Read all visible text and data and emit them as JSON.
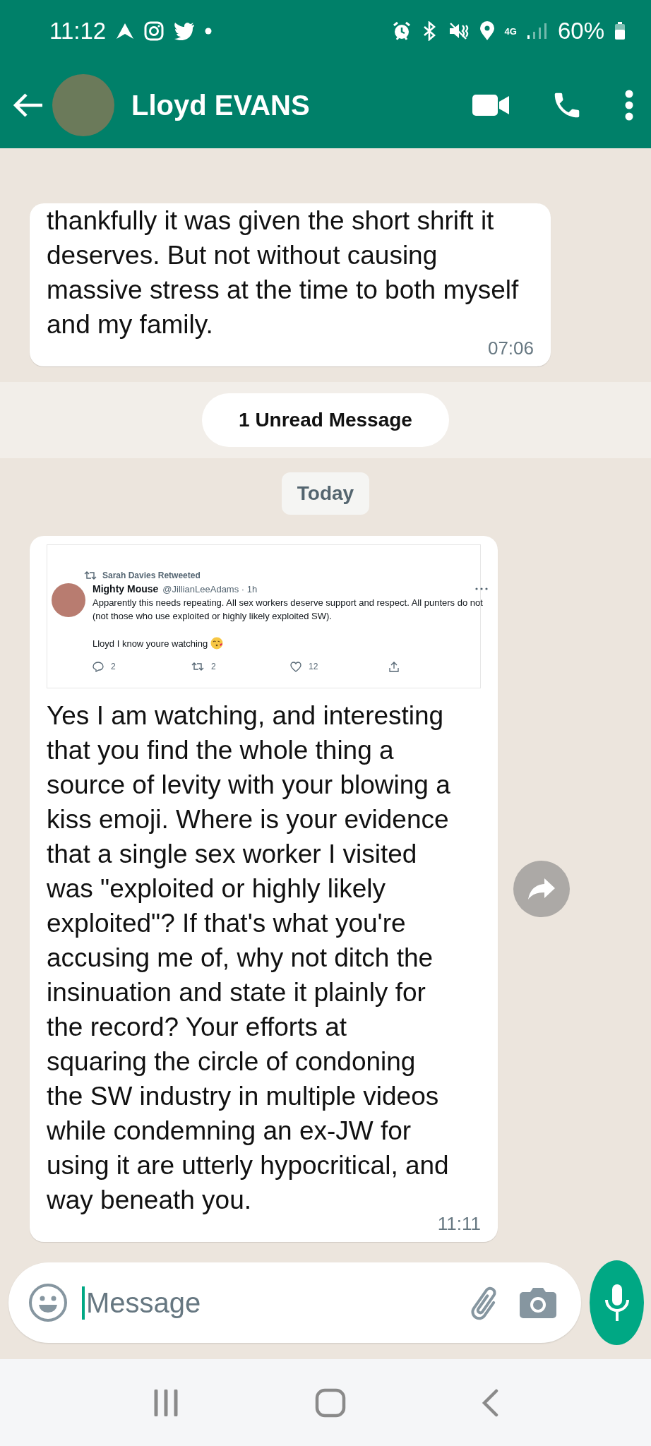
{
  "status_bar": {
    "time": "11:12",
    "network": "4G",
    "battery": "60%"
  },
  "header": {
    "contact_name": "Lloyd EVANS"
  },
  "chat": [
    {
      "kind": "message",
      "text": "thankfully it was given the short shrift it deserves. But not without causing massive stress at the time to both myself and my family.",
      "time": "07:06"
    },
    {
      "kind": "unread",
      "text": "1 Unread Message"
    },
    {
      "kind": "date",
      "text": "Today"
    },
    {
      "kind": "message",
      "forward_button": true,
      "quoted_tweet": {
        "retweeted_by": "Sarah Davies Retweeted",
        "name": "Mighty Mouse",
        "handle": "@JillianLeeAdams · 1h",
        "body": "Apparently this needs repeating. All sex workers deserve support and respect. All punters do not (not those who use exploited or highly likely exploited SW).",
        "body_2": "Lloyd I know youre watching",
        "replies": "2",
        "retweets": "2",
        "likes": "12"
      },
      "text": "Yes I am watching, and interesting that you find the whole thing a source of levity with your blowing a kiss emoji. Where is your evidence that a single sex worker I visited was \"exploited or highly likely exploited\"? If that's what you're accusing me of, why not ditch the insinuation and state it plainly for the record? Your efforts at squaring the circle of condoning the SW industry in multiple videos while condemning an ex-JW for using it are utterly hypocritical, and way beneath you.",
      "time": "11:11"
    }
  ],
  "composer": {
    "placeholder": "Message"
  }
}
